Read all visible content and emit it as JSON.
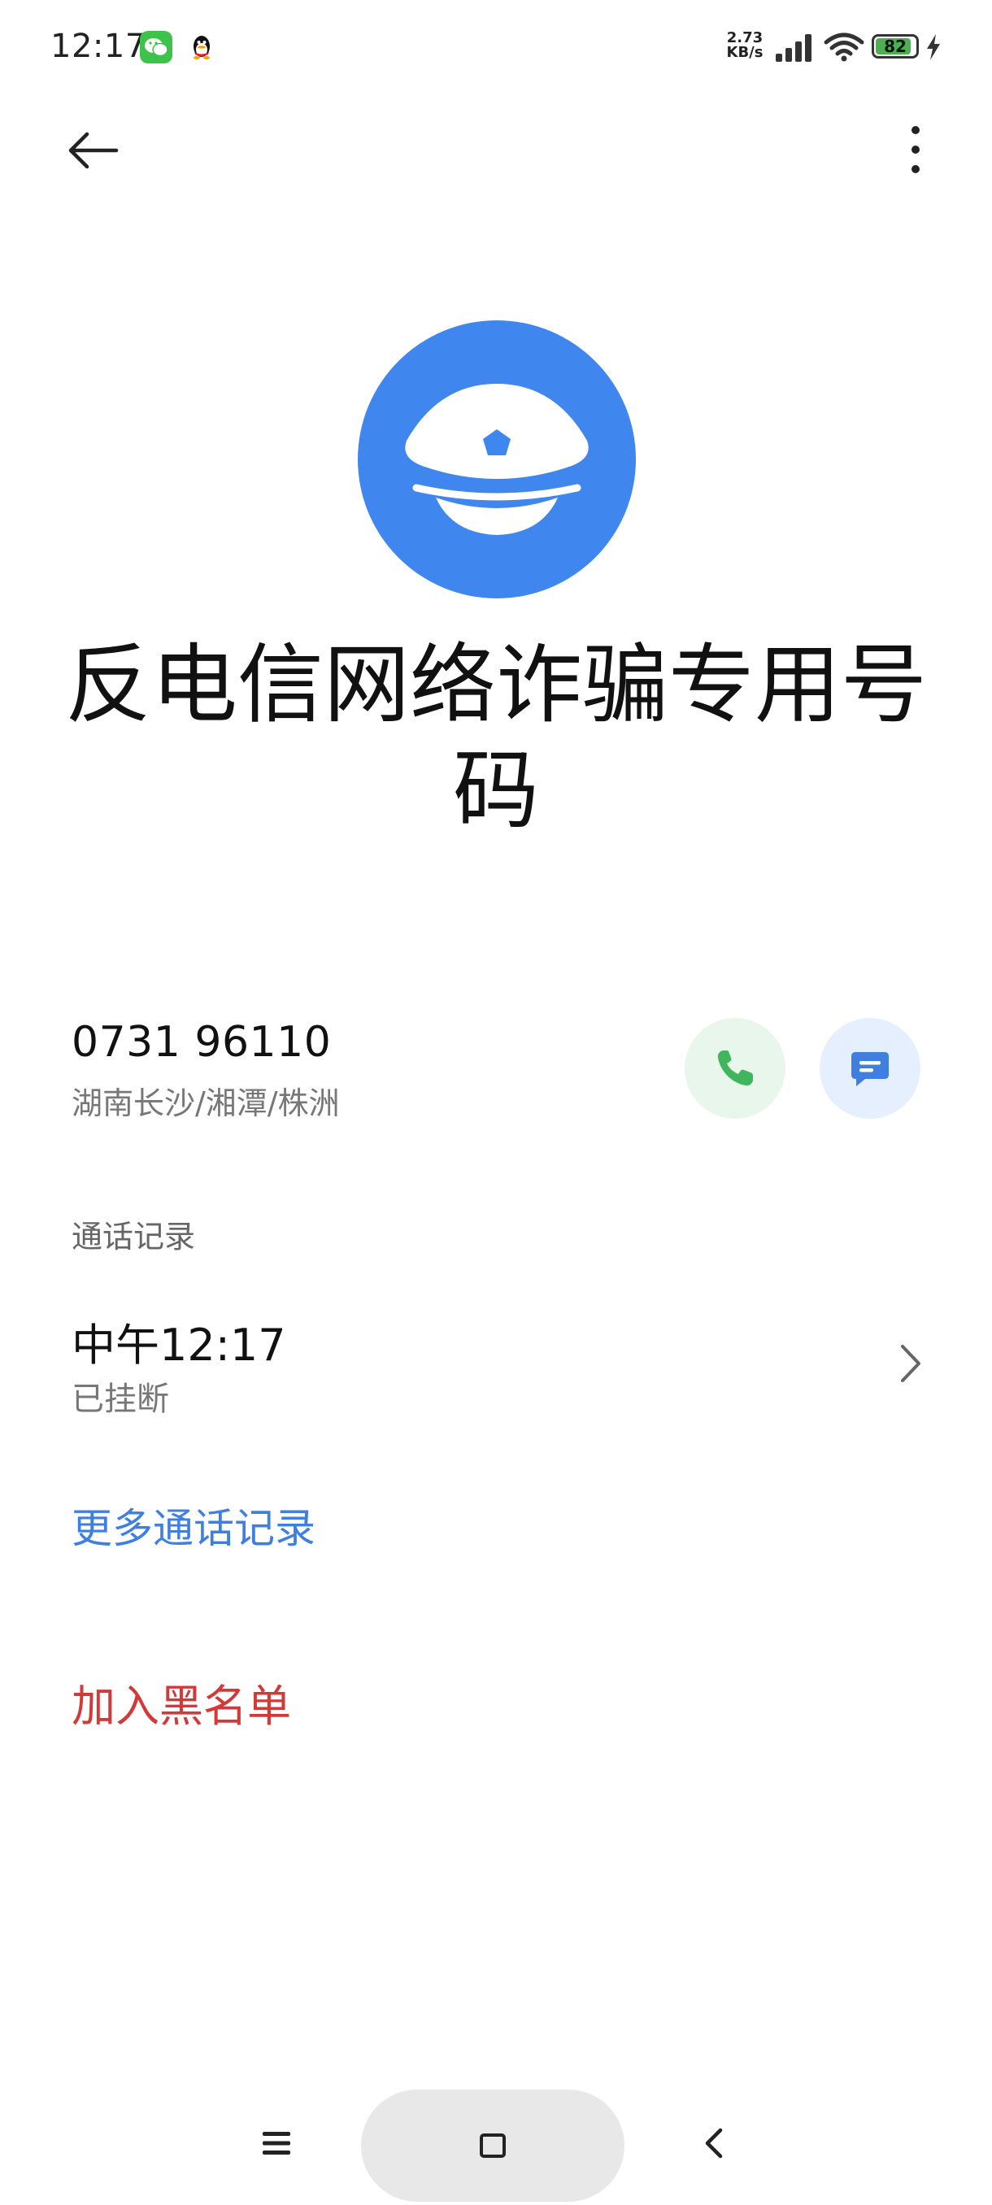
{
  "status_bar": {
    "time": "12:17",
    "net_speed_value": "2.73",
    "net_speed_unit": "KB/s",
    "battery_level": "82",
    "icons": [
      "wechat-icon",
      "qq-icon",
      "signal-icon",
      "wifi-icon",
      "battery-icon",
      "charging-icon"
    ]
  },
  "app_bar": {
    "icons": [
      "back-arrow-icon",
      "more-options-icon"
    ]
  },
  "contact": {
    "name": "反电信网络诈骗专用号码",
    "avatar_icon": "police-cap-icon",
    "avatar_color": "#3f86ee",
    "number": "0731 96110",
    "location": "湖南长沙/湘潭/株洲",
    "call_icon": "phone-icon",
    "message_icon": "message-icon"
  },
  "call_log": {
    "section_title": "通话记录",
    "entries": [
      {
        "time": "中午12:17",
        "status": "已挂断"
      }
    ],
    "more_link": "更多通话记录"
  },
  "actions": {
    "blacklist": "加入黑名单",
    "blacklist_color": "#d23a3a",
    "link_color": "#3e7fe0"
  },
  "nav_bar": {
    "icons": [
      "menu-icon",
      "home-icon",
      "back-icon"
    ]
  }
}
